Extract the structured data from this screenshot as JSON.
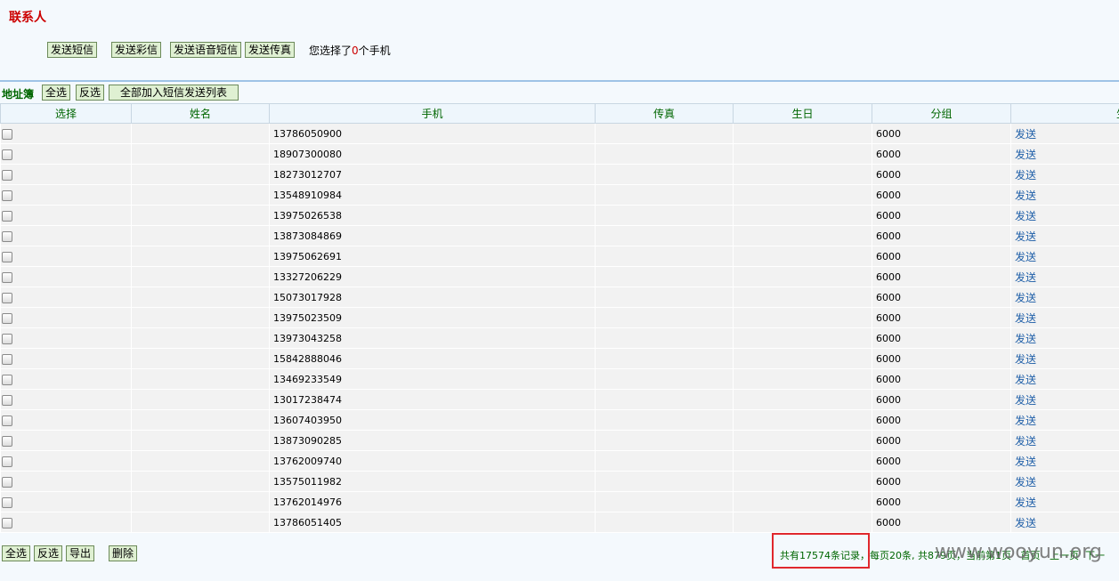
{
  "page": {
    "title": "联系人"
  },
  "toolbar": {
    "send_sms": "发送短信",
    "send_mms": "发送彩信",
    "send_voice_sms": "发送语音短信",
    "send_fax": "发送传真",
    "selected_prefix": "您选择了",
    "selected_count": "0",
    "selected_suffix": "个手机"
  },
  "address_book": {
    "label": "地址簿",
    "select_all": "全选",
    "invert": "反选",
    "add_all_to_sms_list": "全部加入短信发送列表"
  },
  "table": {
    "columns": [
      "选择",
      "姓名",
      "手机",
      "传真",
      "生日",
      "分组",
      "生"
    ],
    "send_label": "发送",
    "rows": [
      {
        "name": "",
        "mobile": "13786050900",
        "fax": "",
        "birthday": "",
        "group": "6000"
      },
      {
        "name": "",
        "mobile": "18907300080",
        "fax": "",
        "birthday": "",
        "group": "6000"
      },
      {
        "name": "",
        "mobile": "18273012707",
        "fax": "",
        "birthday": "",
        "group": "6000"
      },
      {
        "name": "",
        "mobile": "13548910984",
        "fax": "",
        "birthday": "",
        "group": "6000"
      },
      {
        "name": "",
        "mobile": "13975026538",
        "fax": "",
        "birthday": "",
        "group": "6000"
      },
      {
        "name": "",
        "mobile": "13873084869",
        "fax": "",
        "birthday": "",
        "group": "6000"
      },
      {
        "name": "",
        "mobile": "13975062691",
        "fax": "",
        "birthday": "",
        "group": "6000"
      },
      {
        "name": "",
        "mobile": "13327206229",
        "fax": "",
        "birthday": "",
        "group": "6000"
      },
      {
        "name": "",
        "mobile": "15073017928",
        "fax": "",
        "birthday": "",
        "group": "6000"
      },
      {
        "name": "",
        "mobile": "13975023509",
        "fax": "",
        "birthday": "",
        "group": "6000"
      },
      {
        "name": "",
        "mobile": "13973043258",
        "fax": "",
        "birthday": "",
        "group": "6000"
      },
      {
        "name": "",
        "mobile": "15842888046",
        "fax": "",
        "birthday": "",
        "group": "6000"
      },
      {
        "name": "",
        "mobile": "13469233549",
        "fax": "",
        "birthday": "",
        "group": "6000"
      },
      {
        "name": "",
        "mobile": "13017238474",
        "fax": "",
        "birthday": "",
        "group": "6000"
      },
      {
        "name": "",
        "mobile": "13607403950",
        "fax": "",
        "birthday": "",
        "group": "6000"
      },
      {
        "name": "",
        "mobile": "13873090285",
        "fax": "",
        "birthday": "",
        "group": "6000"
      },
      {
        "name": "",
        "mobile": "13762009740",
        "fax": "",
        "birthday": "",
        "group": "6000"
      },
      {
        "name": "",
        "mobile": "13575011982",
        "fax": "",
        "birthday": "",
        "group": "6000"
      },
      {
        "name": "",
        "mobile": "13762014976",
        "fax": "",
        "birthday": "",
        "group": "6000"
      },
      {
        "name": "",
        "mobile": "13786051405",
        "fax": "",
        "birthday": "",
        "group": "6000"
      }
    ]
  },
  "footer": {
    "select_all": "全选",
    "invert": "反选",
    "export": "导出",
    "delete": "删除",
    "total_records": "共有17574条记录，",
    "page_info": "每页20条, 共879页，当前第1页",
    "first": "首页",
    "prev": "上一页",
    "next": "下一"
  },
  "watermark": "www.wooyun.org",
  "colors": {
    "title_red": "#cc0000",
    "header_green": "#006600",
    "link_blue": "#1f5fa8",
    "highlight_red": "#e0282d"
  }
}
